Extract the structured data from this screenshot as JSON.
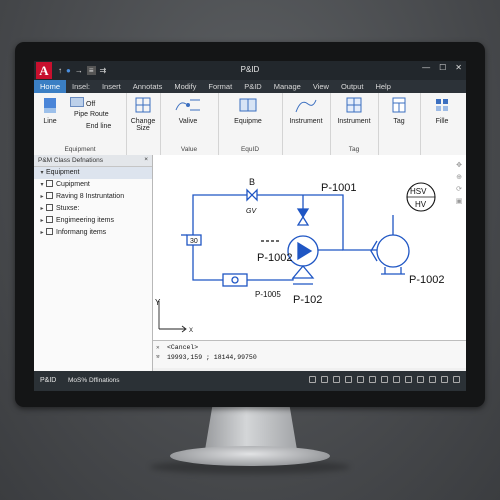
{
  "window": {
    "title": "P&ID",
    "app_letter": "A",
    "qat_icons": [
      "arrow-icon",
      "dot-icon",
      "arrow-icon",
      "list-icon",
      "swap-icon"
    ],
    "controls": [
      "—",
      "☐",
      "✕"
    ]
  },
  "menu": [
    "Home",
    "Insel:",
    "Insert",
    "Annotats",
    "Modify",
    "Format",
    "P&ID",
    "Manage",
    "View",
    "Output",
    "Help"
  ],
  "ribbon": {
    "line": "Line",
    "pipe_route": "Pipe Route",
    "off": "Off",
    "end_line": "End line",
    "equipment_group": "Equipment",
    "change_size_1": "Change",
    "change_size_2": "Size",
    "valve": "Valive",
    "valve_group": "Value",
    "equipment": "Equipme",
    "equid_group": "EquID",
    "instrument1": "Instrument",
    "instrument2": "Instrument",
    "tag_group": "Tag",
    "tag": "Tag",
    "file": "Fille"
  },
  "panel": {
    "header": "P&M Class Defnations",
    "items": [
      {
        "label": "Equipment",
        "expander": "▾",
        "sel": true
      },
      {
        "label": "Cupipment",
        "expander": "▾"
      },
      {
        "label": "Raving 8 Instruntation",
        "expander": "▸"
      },
      {
        "label": "Stuxse:",
        "expander": "▸"
      },
      {
        "label": "Engimeering items",
        "expander": "▸"
      },
      {
        "label": "Informang items",
        "expander": "▸"
      }
    ]
  },
  "drawing": {
    "labels": {
      "b": "B",
      "gv": "GV",
      "p1001": "P-1001",
      "p1002a": "P-1002",
      "p1002b": "P-1002",
      "p1005": "P-1005",
      "p102": "P-102",
      "hsv": "HSV",
      "hv": "HV",
      "box30": "30",
      "ucs_y": "Y",
      "ucs_x": "X"
    },
    "line_color": "#1f56c4"
  },
  "command": {
    "line1": "<Cancel>",
    "line2": "19993,159 ; 18144,99750"
  },
  "status": {
    "left": "P&ID",
    "mid": "MoS% Dffinations"
  }
}
